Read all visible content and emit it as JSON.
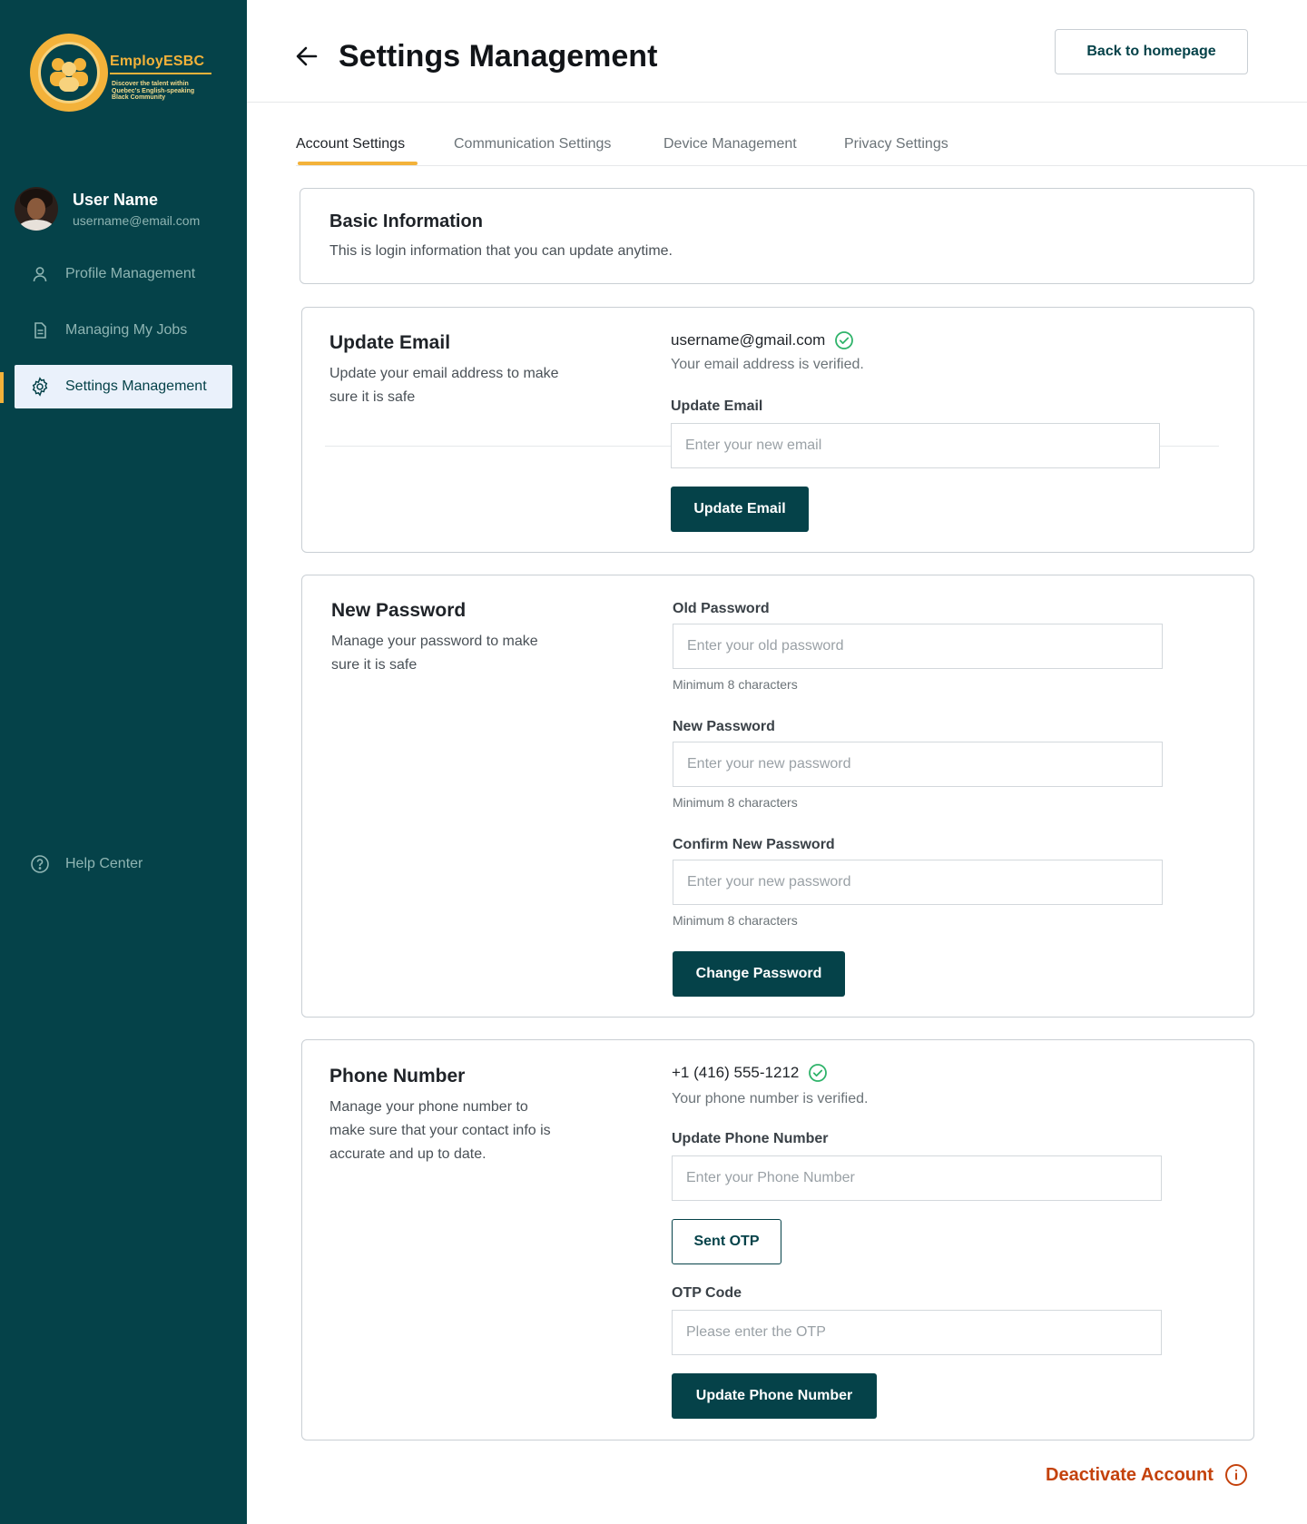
{
  "brand": {
    "name": "EmployESBC",
    "tagline": "Discover the talent within Quebec's English-speaking Black Community",
    "accent_color": "#f3b23a",
    "primary_color": "#054249"
  },
  "user": {
    "name": "User Name",
    "email": "username@email.com"
  },
  "sidebar": {
    "items": [
      {
        "label": "Profile Management",
        "icon": "user-icon"
      },
      {
        "label": "Managing My Jobs",
        "icon": "document-icon"
      },
      {
        "label": "Settings Management",
        "icon": "gear-icon",
        "active": true
      }
    ],
    "help": {
      "label": "Help Center",
      "icon": "question-circle-icon"
    }
  },
  "header": {
    "title": "Settings Management",
    "back_button_label": "Back to homepage"
  },
  "tabs": [
    {
      "label": "Account Settings",
      "active": true
    },
    {
      "label": "Communication Settings"
    },
    {
      "label": "Device Management"
    },
    {
      "label": "Privacy Settings"
    }
  ],
  "basic_info": {
    "title": "Basic Information",
    "description": "This is login information that you can update anytime."
  },
  "email_section": {
    "title": "Update Email",
    "description": "Update your email address to make sure it is safe",
    "current_email": "username@gmail.com",
    "verified_text": "Your email address is verified.",
    "field_label": "Update Email",
    "placeholder": "Enter your new email",
    "button_label": "Update Email"
  },
  "password_section": {
    "title": "New Password",
    "description": "Manage your password to make sure it is safe",
    "old_label": "Old Password",
    "old_placeholder": "Enter your old password",
    "new_label": "New Password",
    "new_placeholder": "Enter your new password",
    "confirm_label": "Confirm New Password",
    "confirm_placeholder": "Enter your new password",
    "hint": "Minimum 8 characters",
    "button_label": "Change Password"
  },
  "phone_section": {
    "title": "Phone Number",
    "description": "Manage your phone number  to make sure that your contact info is accurate and up to date.",
    "current_phone": "+1 (416) 555-1212",
    "verified_text": "Your phone number is verified.",
    "field_label": "Update Phone Number",
    "placeholder": "Enter your Phone Number",
    "otp_button_label": "Sent OTP",
    "otp_label": "OTP Code",
    "otp_placeholder": "Please enter the OTP",
    "button_label": "Update Phone Number"
  },
  "deactivate_label": "Deactivate Account"
}
